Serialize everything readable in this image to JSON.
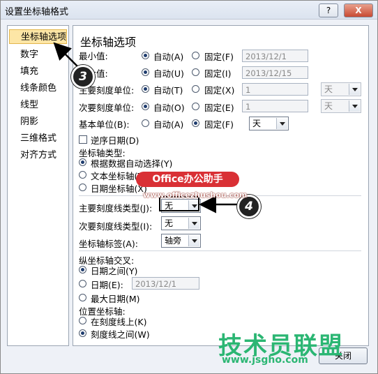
{
  "window": {
    "title": "设置坐标轴格式",
    "help_label": "?",
    "close_label": "X"
  },
  "sidebar": {
    "items": [
      {
        "label": "坐标轴选项",
        "selected": true
      },
      {
        "label": "数字"
      },
      {
        "label": "填充"
      },
      {
        "label": "线条颜色"
      },
      {
        "label": "线型"
      },
      {
        "label": "阴影"
      },
      {
        "label": "三维格式"
      },
      {
        "label": "对齐方式"
      }
    ]
  },
  "panel": {
    "heading": "坐标轴选项",
    "rows": [
      {
        "label": "最小值:",
        "auto": "自动(A)",
        "fixed": "固定(F)",
        "value": "2013/12/1",
        "selected": "auto"
      },
      {
        "label": "最大值:",
        "auto": "自动(U)",
        "fixed": "固定(I)",
        "value": "2013/12/15",
        "selected": "auto"
      },
      {
        "label": "主要刻度单位:",
        "auto": "自动(T)",
        "fixed": "固定(X)",
        "value": "1",
        "unit": "天",
        "selected": "auto"
      },
      {
        "label": "次要刻度单位:",
        "auto": "自动(O)",
        "fixed": "固定(E)",
        "value": "1",
        "unit": "天",
        "selected": "auto"
      },
      {
        "label": "基本单位(B):",
        "auto": "自动(A)",
        "fixed": "固定(F)",
        "unit": "天",
        "selected": "fixed"
      }
    ],
    "reverse_dates": "逆序日期(D)",
    "axis_type": {
      "label": "坐标轴类型:",
      "options": [
        "根据数据自动选择(Y)",
        "文本坐标轴(T)",
        "日期坐标轴(X)"
      ],
      "selected": 0
    },
    "major_tick_type": {
      "label": "主要刻度线类型(J):",
      "value": "无"
    },
    "minor_tick_type": {
      "label": "次要刻度线类型(I):",
      "value": "无"
    },
    "axis_labels": {
      "label": "坐标轴标签(A):",
      "value": "轴旁"
    },
    "vertical_cross": {
      "label": "纵坐标轴交叉:",
      "options": [
        "日期之间(Y)",
        "日期(E):",
        "最大日期(M)"
      ],
      "date_value": "2013/12/1",
      "selected": 0
    },
    "position": {
      "label": "位置坐标轴:",
      "options": [
        "在刻度线上(K)",
        "刻度线之间(W)"
      ],
      "selected": 1
    }
  },
  "close_button": "关闭",
  "overlay": {
    "badge_3": "3",
    "badge_4": "4",
    "banner": "Office办公助手",
    "url": "www.officezhushou.com",
    "watermark": "技术员联盟",
    "watermark_url": "www.jsgho.com"
  }
}
